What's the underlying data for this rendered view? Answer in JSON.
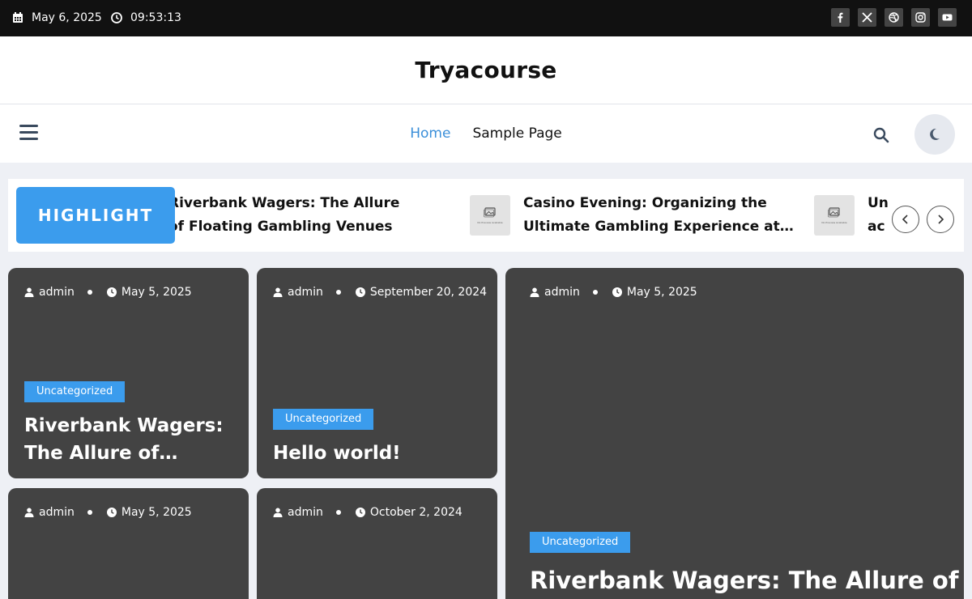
{
  "topbar": {
    "date": "May 6, 2025",
    "time": "09:53:13",
    "social": [
      "facebook-icon",
      "x-icon",
      "dribbble-icon",
      "instagram-icon",
      "youtube-icon"
    ]
  },
  "header": {
    "site_title": "Tryacourse"
  },
  "nav": {
    "items": [
      {
        "label": "Home",
        "active": true
      },
      {
        "label": "Sample Page",
        "active": false
      }
    ]
  },
  "highlight": {
    "badge": "HIGHLIGHT",
    "items": [
      {
        "title": "Riverbank Wagers: The Allure of Floating Gambling Venues"
      },
      {
        "title": "Casino Evening: Organizing the Ultimate Gambling Experience at You...",
        "thumb_text": "No Preview Available"
      },
      {
        "title": "Un ac",
        "thumb_text": "No Preview Available"
      }
    ]
  },
  "posts": [
    {
      "author": "admin",
      "date": "May 5, 2025",
      "category": "Uncategorized",
      "title": "Riverbank Wagers: The Allure of Floatin..."
    },
    {
      "author": "admin",
      "date": "September 20, 2024",
      "category": "Uncategorized",
      "title": "Hello world!"
    },
    {
      "author": "admin",
      "date": "May 5, 2025",
      "category": "Uncategorized",
      "title": "Riverbank Wagers: The Allure of"
    },
    {
      "author": "admin",
      "date": "May 5, 2025"
    },
    {
      "author": "admin",
      "date": "October 2, 2024"
    }
  ],
  "colors": {
    "accent": "#3b9ced",
    "nav_active": "#3b8fd9",
    "card_bg": "#434343",
    "topbar_bg": "#111111"
  }
}
